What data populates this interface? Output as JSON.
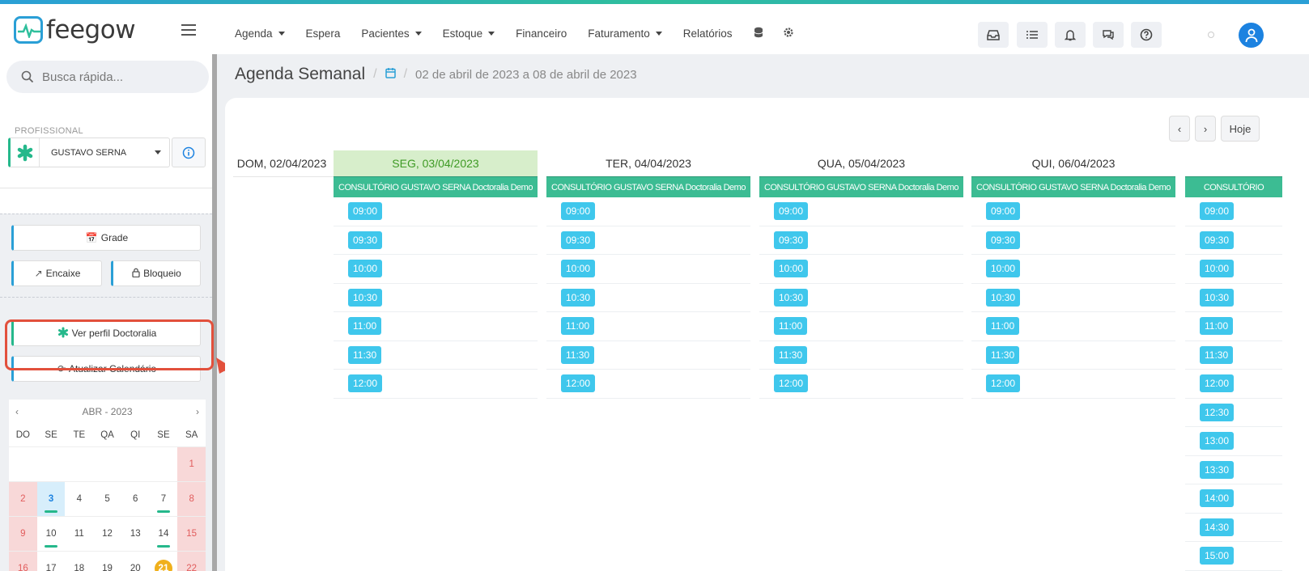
{
  "app": {
    "name": "feegow"
  },
  "nav": {
    "items": [
      {
        "label": "Agenda",
        "dropdown": true
      },
      {
        "label": "Espera",
        "dropdown": false
      },
      {
        "label": "Pacientes",
        "dropdown": true
      },
      {
        "label": "Estoque",
        "dropdown": true
      },
      {
        "label": "Financeiro",
        "dropdown": false
      },
      {
        "label": "Faturamento",
        "dropdown": true
      },
      {
        "label": "Relatórios",
        "dropdown": false
      }
    ],
    "icons": [
      "database-icon",
      "gear-icon"
    ]
  },
  "toolbar_icons": [
    "inbox-icon",
    "checklist-icon",
    "bell-icon",
    "chat-icon",
    "help-icon"
  ],
  "search": {
    "placeholder": "Busca rápida..."
  },
  "professional": {
    "label": "PROFISSIONAL",
    "name": "GUSTAVO SERNA"
  },
  "sidebar": {
    "grade": "Grade",
    "encaixe": "Encaixe",
    "bloqueio": "Bloqueio",
    "doctoralia": "Ver perfil Doctoralia",
    "refresh": "Atualizar Calendário"
  },
  "mini_calendar": {
    "month": "ABR - 2023",
    "weekdays": [
      "DO",
      "SE",
      "TE",
      "QA",
      "QI",
      "SE",
      "SA"
    ],
    "weeks": [
      [
        "",
        "",
        "",
        "",
        "",
        "",
        "1"
      ],
      [
        "2",
        "3",
        "4",
        "5",
        "6",
        "7",
        "8"
      ],
      [
        "9",
        "10",
        "11",
        "12",
        "13",
        "14",
        "15"
      ],
      [
        "16",
        "17",
        "18",
        "19",
        "20",
        "21",
        "22"
      ]
    ],
    "today": "3",
    "selected": "21",
    "marked": [
      "3",
      "7",
      "10",
      "14",
      "17"
    ]
  },
  "breadcrumb": {
    "title": "Agenda Semanal",
    "range": "02 de abril de 2023 a 08 de abril de 2023"
  },
  "week_nav": {
    "today_label": "Hoje"
  },
  "schedule": {
    "location": "CONSULTÓRIO GUSTAVO SERNA Doctoralia Demo",
    "days": [
      {
        "label": "DOM, 02/04/2023",
        "slots": []
      },
      {
        "label": "SEG, 03/04/2023",
        "active": true,
        "slots": [
          "09:00",
          "09:30",
          "10:00",
          "10:30",
          "11:00",
          "11:30",
          "12:00"
        ]
      },
      {
        "label": "TER, 04/04/2023",
        "slots": [
          "09:00",
          "09:30",
          "10:00",
          "10:30",
          "11:00",
          "11:30",
          "12:00"
        ]
      },
      {
        "label": "QUA, 05/04/2023",
        "slots": [
          "09:00",
          "09:30",
          "10:00",
          "10:30",
          "11:00",
          "11:30",
          "12:00"
        ]
      },
      {
        "label": "QUI, 06/04/2023",
        "slots": [
          "09:00",
          "09:30",
          "10:00",
          "10:30",
          "11:00",
          "11:30",
          "12:00"
        ]
      },
      {
        "label": "",
        "location_label": "CONSULTÓRIO",
        "slots": [
          "09:00",
          "09:30",
          "10:00",
          "10:30",
          "11:00",
          "11:30",
          "12:00",
          "12:30",
          "13:00",
          "13:30",
          "14:00",
          "14:30",
          "15:00"
        ]
      }
    ]
  },
  "colors": {
    "brand": "#2a9fd6",
    "green": "#25b88b",
    "slot": "#3fc7ec",
    "location_bar": "#3cbc93",
    "highlight": "#e2503c"
  }
}
